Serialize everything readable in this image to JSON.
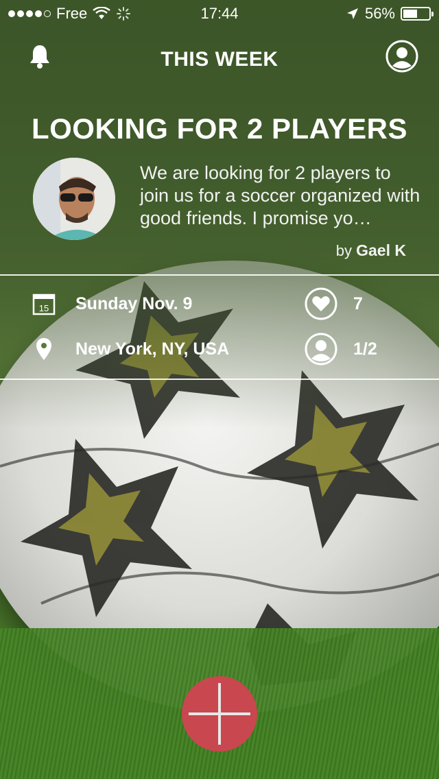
{
  "status_bar": {
    "carrier": "Free",
    "time": "17:44",
    "battery_percent": "56%",
    "battery_level": 0.56
  },
  "nav": {
    "title": "THIS WEEK",
    "left_icon": "bell-icon",
    "right_icon": "profile-icon"
  },
  "post": {
    "headline": "LOOKING FOR 2 PLAYERS",
    "description": "We are looking for 2 players to join us for a soccer organized with good friends. I promise yo…",
    "by_prefix": "by",
    "author": "Gael K"
  },
  "details": {
    "date": "Sunday Nov. 9",
    "calendar_day": "15",
    "location": "New York, NY, USA",
    "likes": "7",
    "players": "1/2"
  },
  "fab": {
    "icon": "plus-icon",
    "color": "#c9474f"
  }
}
